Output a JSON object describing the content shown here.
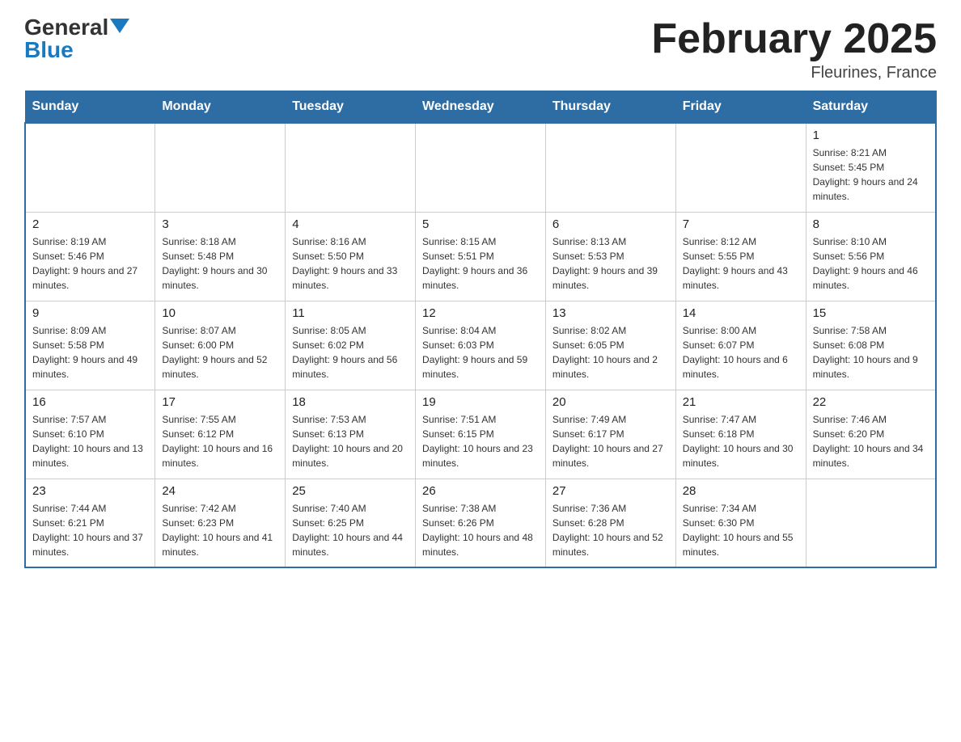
{
  "logo": {
    "general": "General",
    "blue": "Blue"
  },
  "title": "February 2025",
  "location": "Fleurines, France",
  "days_of_week": [
    "Sunday",
    "Monday",
    "Tuesday",
    "Wednesday",
    "Thursday",
    "Friday",
    "Saturday"
  ],
  "weeks": [
    [
      {
        "day": "",
        "info": ""
      },
      {
        "day": "",
        "info": ""
      },
      {
        "day": "",
        "info": ""
      },
      {
        "day": "",
        "info": ""
      },
      {
        "day": "",
        "info": ""
      },
      {
        "day": "",
        "info": ""
      },
      {
        "day": "1",
        "info": "Sunrise: 8:21 AM\nSunset: 5:45 PM\nDaylight: 9 hours and 24 minutes."
      }
    ],
    [
      {
        "day": "2",
        "info": "Sunrise: 8:19 AM\nSunset: 5:46 PM\nDaylight: 9 hours and 27 minutes."
      },
      {
        "day": "3",
        "info": "Sunrise: 8:18 AM\nSunset: 5:48 PM\nDaylight: 9 hours and 30 minutes."
      },
      {
        "day": "4",
        "info": "Sunrise: 8:16 AM\nSunset: 5:50 PM\nDaylight: 9 hours and 33 minutes."
      },
      {
        "day": "5",
        "info": "Sunrise: 8:15 AM\nSunset: 5:51 PM\nDaylight: 9 hours and 36 minutes."
      },
      {
        "day": "6",
        "info": "Sunrise: 8:13 AM\nSunset: 5:53 PM\nDaylight: 9 hours and 39 minutes."
      },
      {
        "day": "7",
        "info": "Sunrise: 8:12 AM\nSunset: 5:55 PM\nDaylight: 9 hours and 43 minutes."
      },
      {
        "day": "8",
        "info": "Sunrise: 8:10 AM\nSunset: 5:56 PM\nDaylight: 9 hours and 46 minutes."
      }
    ],
    [
      {
        "day": "9",
        "info": "Sunrise: 8:09 AM\nSunset: 5:58 PM\nDaylight: 9 hours and 49 minutes."
      },
      {
        "day": "10",
        "info": "Sunrise: 8:07 AM\nSunset: 6:00 PM\nDaylight: 9 hours and 52 minutes."
      },
      {
        "day": "11",
        "info": "Sunrise: 8:05 AM\nSunset: 6:02 PM\nDaylight: 9 hours and 56 minutes."
      },
      {
        "day": "12",
        "info": "Sunrise: 8:04 AM\nSunset: 6:03 PM\nDaylight: 9 hours and 59 minutes."
      },
      {
        "day": "13",
        "info": "Sunrise: 8:02 AM\nSunset: 6:05 PM\nDaylight: 10 hours and 2 minutes."
      },
      {
        "day": "14",
        "info": "Sunrise: 8:00 AM\nSunset: 6:07 PM\nDaylight: 10 hours and 6 minutes."
      },
      {
        "day": "15",
        "info": "Sunrise: 7:58 AM\nSunset: 6:08 PM\nDaylight: 10 hours and 9 minutes."
      }
    ],
    [
      {
        "day": "16",
        "info": "Sunrise: 7:57 AM\nSunset: 6:10 PM\nDaylight: 10 hours and 13 minutes."
      },
      {
        "day": "17",
        "info": "Sunrise: 7:55 AM\nSunset: 6:12 PM\nDaylight: 10 hours and 16 minutes."
      },
      {
        "day": "18",
        "info": "Sunrise: 7:53 AM\nSunset: 6:13 PM\nDaylight: 10 hours and 20 minutes."
      },
      {
        "day": "19",
        "info": "Sunrise: 7:51 AM\nSunset: 6:15 PM\nDaylight: 10 hours and 23 minutes."
      },
      {
        "day": "20",
        "info": "Sunrise: 7:49 AM\nSunset: 6:17 PM\nDaylight: 10 hours and 27 minutes."
      },
      {
        "day": "21",
        "info": "Sunrise: 7:47 AM\nSunset: 6:18 PM\nDaylight: 10 hours and 30 minutes."
      },
      {
        "day": "22",
        "info": "Sunrise: 7:46 AM\nSunset: 6:20 PM\nDaylight: 10 hours and 34 minutes."
      }
    ],
    [
      {
        "day": "23",
        "info": "Sunrise: 7:44 AM\nSunset: 6:21 PM\nDaylight: 10 hours and 37 minutes."
      },
      {
        "day": "24",
        "info": "Sunrise: 7:42 AM\nSunset: 6:23 PM\nDaylight: 10 hours and 41 minutes."
      },
      {
        "day": "25",
        "info": "Sunrise: 7:40 AM\nSunset: 6:25 PM\nDaylight: 10 hours and 44 minutes."
      },
      {
        "day": "26",
        "info": "Sunrise: 7:38 AM\nSunset: 6:26 PM\nDaylight: 10 hours and 48 minutes."
      },
      {
        "day": "27",
        "info": "Sunrise: 7:36 AM\nSunset: 6:28 PM\nDaylight: 10 hours and 52 minutes."
      },
      {
        "day": "28",
        "info": "Sunrise: 7:34 AM\nSunset: 6:30 PM\nDaylight: 10 hours and 55 minutes."
      },
      {
        "day": "",
        "info": ""
      }
    ]
  ]
}
